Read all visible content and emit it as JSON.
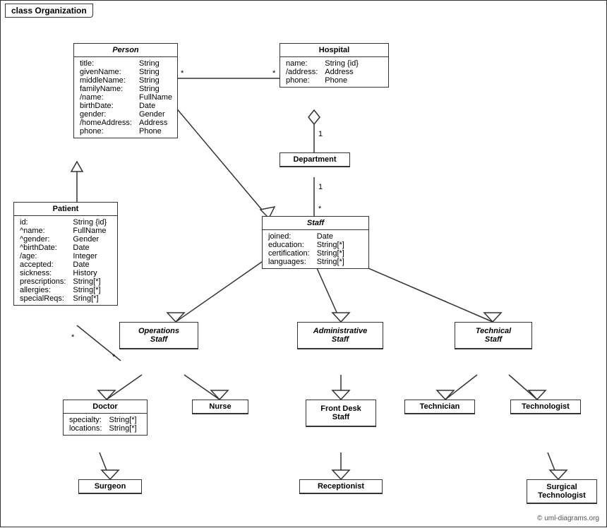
{
  "diagram": {
    "title": "class Organization",
    "copyright": "© uml-diagrams.org",
    "classes": {
      "person": {
        "name": "Person",
        "italic": true,
        "attrs": [
          [
            "title:",
            "String"
          ],
          [
            "givenName:",
            "String"
          ],
          [
            "middleName:",
            "String"
          ],
          [
            "familyName:",
            "String"
          ],
          [
            "/name:",
            "FullName"
          ],
          [
            "birthDate:",
            "Date"
          ],
          [
            "gender:",
            "Gender"
          ],
          [
            "/homeAddress:",
            "Address"
          ],
          [
            "phone:",
            "Phone"
          ]
        ]
      },
      "hospital": {
        "name": "Hospital",
        "italic": false,
        "attrs": [
          [
            "name:",
            "String {id}"
          ],
          [
            "/address:",
            "Address"
          ],
          [
            "phone:",
            "Phone"
          ]
        ]
      },
      "department": {
        "name": "Department",
        "italic": false,
        "attrs": []
      },
      "staff": {
        "name": "Staff",
        "italic": true,
        "attrs": [
          [
            "joined:",
            "Date"
          ],
          [
            "education:",
            "String[*]"
          ],
          [
            "certification:",
            "String[*]"
          ],
          [
            "languages:",
            "String[*]"
          ]
        ]
      },
      "patient": {
        "name": "Patient",
        "italic": false,
        "attrs": [
          [
            "id:",
            "String {id}"
          ],
          [
            "^name:",
            "FullName"
          ],
          [
            "^gender:",
            "Gender"
          ],
          [
            "^birthDate:",
            "Date"
          ],
          [
            "/age:",
            "Integer"
          ],
          [
            "accepted:",
            "Date"
          ],
          [
            "sickness:",
            "History"
          ],
          [
            "prescriptions:",
            "String[*]"
          ],
          [
            "allergies:",
            "String[*]"
          ],
          [
            "specialReqs:",
            "Sring[*]"
          ]
        ]
      },
      "operationsStaff": {
        "name": "Operations Staff",
        "italic": true,
        "attrs": []
      },
      "administrativeStaff": {
        "name": "Administrative Staff",
        "italic": true,
        "attrs": []
      },
      "technicalStaff": {
        "name": "Technical Staff",
        "italic": true,
        "attrs": []
      },
      "doctor": {
        "name": "Doctor",
        "italic": false,
        "attrs": [
          [
            "specialty:",
            "String[*]"
          ],
          [
            "locations:",
            "String[*]"
          ]
        ]
      },
      "nurse": {
        "name": "Nurse",
        "italic": false,
        "attrs": []
      },
      "frontDeskStaff": {
        "name": "Front Desk Staff",
        "italic": false,
        "attrs": []
      },
      "technician": {
        "name": "Technician",
        "italic": false,
        "attrs": []
      },
      "technologist": {
        "name": "Technologist",
        "italic": false,
        "attrs": []
      },
      "surgeon": {
        "name": "Surgeon",
        "italic": false,
        "attrs": []
      },
      "receptionist": {
        "name": "Receptionist",
        "italic": false,
        "attrs": []
      },
      "surgicalTechnologist": {
        "name": "Surgical Technologist",
        "italic": false,
        "attrs": []
      }
    }
  }
}
